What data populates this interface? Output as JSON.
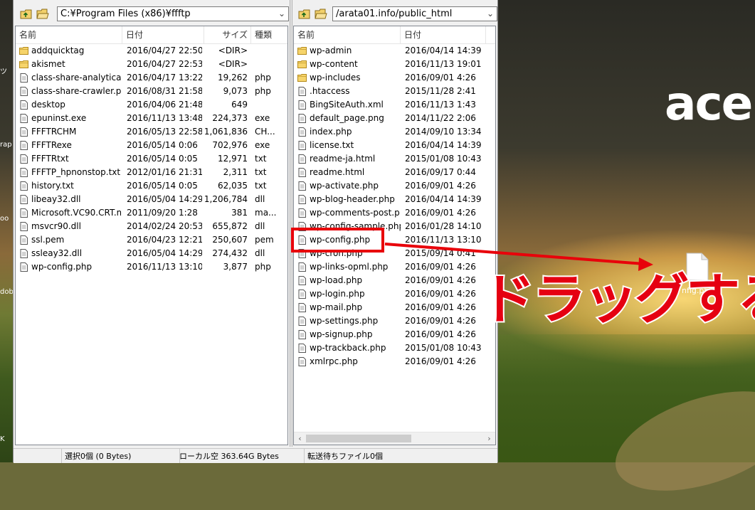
{
  "desktop": {
    "brand": "acer",
    "file_label": "nfig.ph",
    "edge_labels": [
      "ツ",
      "rap",
      "oo",
      "dob",
      "K"
    ]
  },
  "left_pane": {
    "path": "C:¥Program Files (x86)¥ffftp",
    "columns": {
      "name": "名前",
      "date": "日付",
      "size": "サイズ",
      "type": "種類"
    },
    "rows": [
      {
        "icon": "folder",
        "name": "addquicktag",
        "date": "2016/04/27 22:50",
        "size": "<DIR>",
        "type": ""
      },
      {
        "icon": "folder",
        "name": "akismet",
        "date": "2016/04/27 22:53",
        "size": "<DIR>",
        "type": ""
      },
      {
        "icon": "file",
        "name": "class-share-analytical...",
        "date": "2016/04/17 13:22",
        "size": "19,262",
        "type": "php"
      },
      {
        "icon": "file",
        "name": "class-share-crawler.php",
        "date": "2016/08/31 21:58",
        "size": "9,073",
        "type": "php"
      },
      {
        "icon": "file",
        "name": "desktop",
        "date": "2016/04/06 21:48",
        "size": "649",
        "type": ""
      },
      {
        "icon": "file",
        "name": "epuninst.exe",
        "date": "2016/11/13 13:48",
        "size": "224,373",
        "type": "exe"
      },
      {
        "icon": "file",
        "name": "FFFTRCHM",
        "date": "2016/05/13 22:58",
        "size": "1,061,836",
        "type": "CH..."
      },
      {
        "icon": "file",
        "name": "FFFTRexe",
        "date": "2016/05/14 0:06",
        "size": "702,976",
        "type": "exe"
      },
      {
        "icon": "file",
        "name": "FFFTRtxt",
        "date": "2016/05/14 0:05",
        "size": "12,971",
        "type": "txt"
      },
      {
        "icon": "file",
        "name": "FFFTP_hpnonstop.txt",
        "date": "2012/01/16 21:31",
        "size": "2,311",
        "type": "txt"
      },
      {
        "icon": "file",
        "name": "history.txt",
        "date": "2016/05/14 0:05",
        "size": "62,035",
        "type": "txt"
      },
      {
        "icon": "file",
        "name": "libeay32.dll",
        "date": "2016/05/04 14:29",
        "size": "1,206,784",
        "type": "dll"
      },
      {
        "icon": "file",
        "name": "Microsoft.VC90.CRT.m...",
        "date": "2011/09/20 1:28",
        "size": "381",
        "type": "ma..."
      },
      {
        "icon": "file",
        "name": "msvcr90.dll",
        "date": "2014/02/24 20:53",
        "size": "655,872",
        "type": "dll"
      },
      {
        "icon": "file",
        "name": "ssl.pem",
        "date": "2016/04/23 12:21",
        "size": "250,607",
        "type": "pem"
      },
      {
        "icon": "file",
        "name": "ssleay32.dll",
        "date": "2016/05/04 14:29",
        "size": "274,432",
        "type": "dll"
      },
      {
        "icon": "file",
        "name": "wp-config.php",
        "date": "2016/11/13 13:10",
        "size": "3,877",
        "type": "php"
      }
    ]
  },
  "right_pane": {
    "path": "/arata01.info/public_html",
    "columns": {
      "name": "名前",
      "date": "日付"
    },
    "rows": [
      {
        "icon": "folder",
        "name": "wp-admin",
        "date": "2016/04/14 14:39"
      },
      {
        "icon": "folder",
        "name": "wp-content",
        "date": "2016/11/13 19:01"
      },
      {
        "icon": "folder",
        "name": "wp-includes",
        "date": "2016/09/01 4:26"
      },
      {
        "icon": "file",
        "name": ".htaccess",
        "date": "2015/11/28 2:41"
      },
      {
        "icon": "file",
        "name": "BingSiteAuth.xml",
        "date": "2016/11/13 1:43"
      },
      {
        "icon": "file",
        "name": "default_page.png",
        "date": "2014/11/22 2:06"
      },
      {
        "icon": "file",
        "name": "index.php",
        "date": "2014/09/10 13:34"
      },
      {
        "icon": "file",
        "name": "license.txt",
        "date": "2016/04/14 14:39"
      },
      {
        "icon": "file",
        "name": "readme-ja.html",
        "date": "2015/01/08 10:43"
      },
      {
        "icon": "file",
        "name": "readme.html",
        "date": "2016/09/17 0:44"
      },
      {
        "icon": "file",
        "name": "wp-activate.php",
        "date": "2016/09/01 4:26"
      },
      {
        "icon": "file",
        "name": "wp-blog-header.php",
        "date": "2016/04/14 14:39"
      },
      {
        "icon": "file",
        "name": "wp-comments-post.p...",
        "date": "2016/09/01 4:26"
      },
      {
        "icon": "file",
        "name": "wp-config-sample.php",
        "date": "2016/01/28 14:10"
      },
      {
        "icon": "file",
        "name": "wp-config.php",
        "date": "2016/11/13 13:10"
      },
      {
        "icon": "file",
        "name": "wp-cron.php",
        "date": "2015/09/14 0:41"
      },
      {
        "icon": "file",
        "name": "wp-links-opml.php",
        "date": "2016/09/01 4:26"
      },
      {
        "icon": "file",
        "name": "wp-load.php",
        "date": "2016/09/01 4:26"
      },
      {
        "icon": "file",
        "name": "wp-login.php",
        "date": "2016/09/01 4:26"
      },
      {
        "icon": "file",
        "name": "wp-mail.php",
        "date": "2016/09/01 4:26"
      },
      {
        "icon": "file",
        "name": "wp-settings.php",
        "date": "2016/09/01 4:26"
      },
      {
        "icon": "file",
        "name": "wp-signup.php",
        "date": "2016/09/01 4:26"
      },
      {
        "icon": "file",
        "name": "wp-trackback.php",
        "date": "2015/01/08 10:43"
      },
      {
        "icon": "file",
        "name": "xmlrpc.php",
        "date": "2016/09/01 4:26"
      }
    ]
  },
  "drag_ghost": {
    "name": "wp-config.php"
  },
  "annotation": {
    "text": "ドラッグする",
    "color": "#e50012"
  },
  "status": {
    "selection": "選択0個 (0 Bytes)",
    "local_free": "ローカル空 363.64G Bytes",
    "queue": "転送待ちファイル0個"
  }
}
